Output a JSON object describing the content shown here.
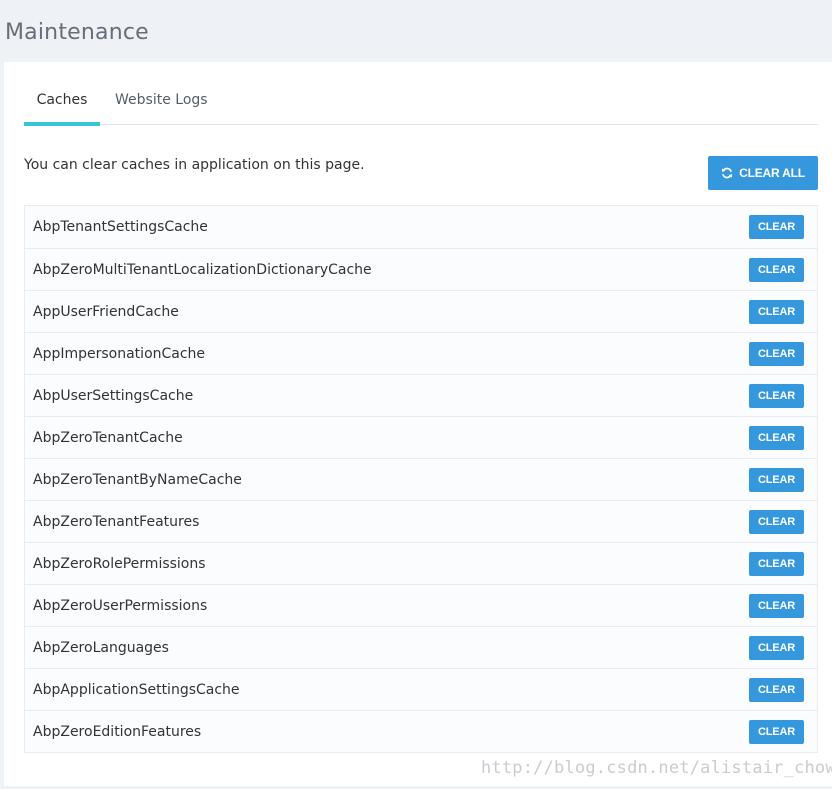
{
  "page": {
    "title": "Maintenance"
  },
  "tabs": [
    {
      "label": "Caches",
      "active": true
    },
    {
      "label": "Website Logs",
      "active": false
    }
  ],
  "intro_text": "You can clear caches in application on this page.",
  "clear_all_label": "CLEAR ALL",
  "clear_label": "CLEAR",
  "caches": [
    "AbpTenantSettingsCache",
    "AbpZeroMultiTenantLocalizationDictionaryCache",
    "AppUserFriendCache",
    "AppImpersonationCache",
    "AbpUserSettingsCache",
    "AbpZeroTenantCache",
    "AbpZeroTenantByNameCache",
    "AbpZeroTenantFeatures",
    "AbpZeroRolePermissions",
    "AbpZeroUserPermissions",
    "AbpZeroLanguages",
    "AbpApplicationSettingsCache",
    "AbpZeroEditionFeatures"
  ],
  "watermark": "http://blog.csdn.net/alistair_chow",
  "colors": {
    "primary": "#3598dc",
    "tab_accent": "#36c6d3",
    "background": "#eef1f5"
  },
  "icons": {
    "clear_all": "refresh-icon"
  }
}
